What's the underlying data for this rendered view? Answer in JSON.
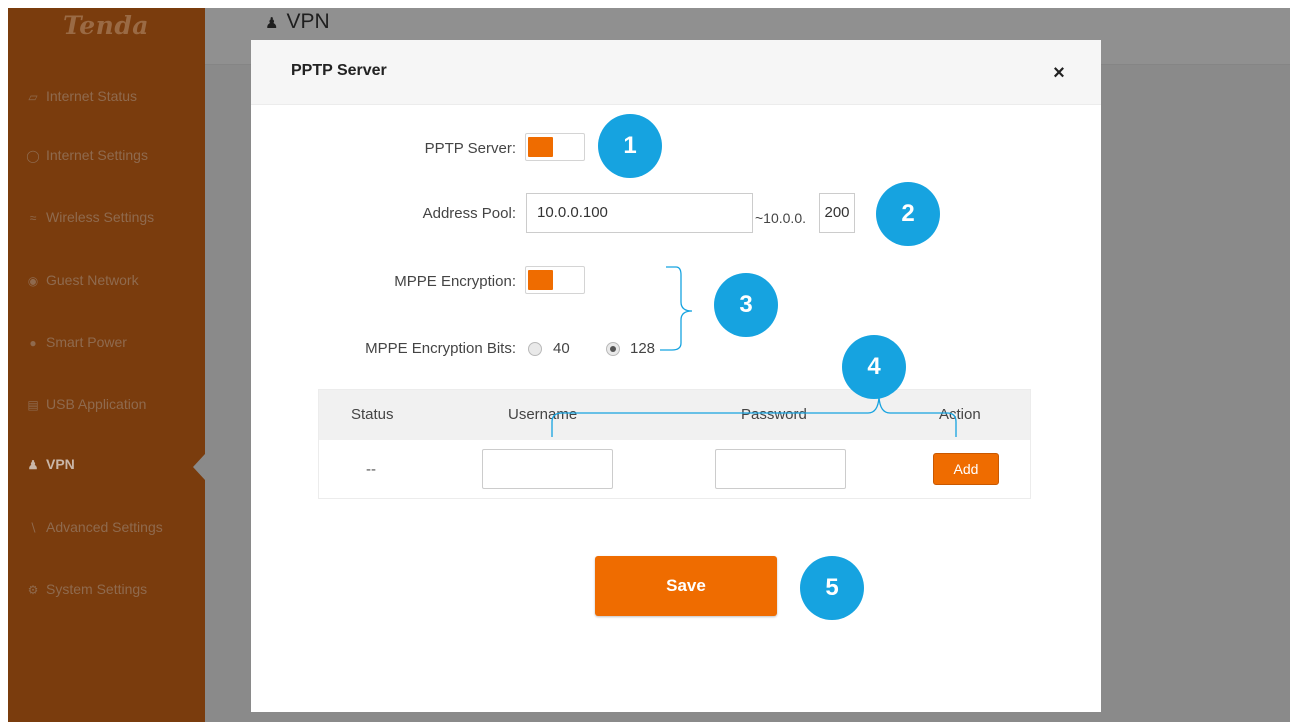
{
  "brand": {
    "logo_text": "Tenda"
  },
  "sidebar": {
    "items": [
      {
        "label": "Internet Status",
        "icon": "monitor-icon"
      },
      {
        "label": "Internet Settings",
        "icon": "globe-icon"
      },
      {
        "label": "Wireless Settings",
        "icon": "wifi-icon"
      },
      {
        "label": "Guest Network",
        "icon": "guest-icon"
      },
      {
        "label": "Smart Power",
        "icon": "bulb-icon"
      },
      {
        "label": "USB Application",
        "icon": "usb-icon"
      },
      {
        "label": "VPN",
        "icon": "vpn-icon",
        "active": true
      },
      {
        "label": "Advanced Settings",
        "icon": "wrench-icon"
      },
      {
        "label": "System Settings",
        "icon": "gear-icon"
      }
    ]
  },
  "header": {
    "title": "VPN"
  },
  "modal": {
    "title": "PPTP Server",
    "close_glyph": "×",
    "pptp_server": {
      "label": "PPTP Server:",
      "enabled": true
    },
    "address_pool": {
      "label": "Address Pool:",
      "start": "10.0.0.100",
      "middle_text": "~10.0.0.",
      "end": "200"
    },
    "mppe_encryption": {
      "label": "MPPE Encryption:",
      "enabled": true
    },
    "mppe_bits": {
      "label": "MPPE Encryption Bits:",
      "options": [
        "40",
        "128"
      ],
      "selected": "128"
    },
    "table": {
      "headers": [
        "Status",
        "Username",
        "Password",
        "Action"
      ],
      "row": {
        "status": "--",
        "username": "",
        "password": "",
        "action_label": "Add"
      }
    },
    "save_label": "Save"
  },
  "callouts": [
    "1",
    "2",
    "3",
    "4",
    "5"
  ],
  "colors": {
    "accent": "#ef6c00",
    "callout": "#16a3e0",
    "sidebar_bg": "#7a3c0d",
    "overlay": "#8a8a8a"
  }
}
